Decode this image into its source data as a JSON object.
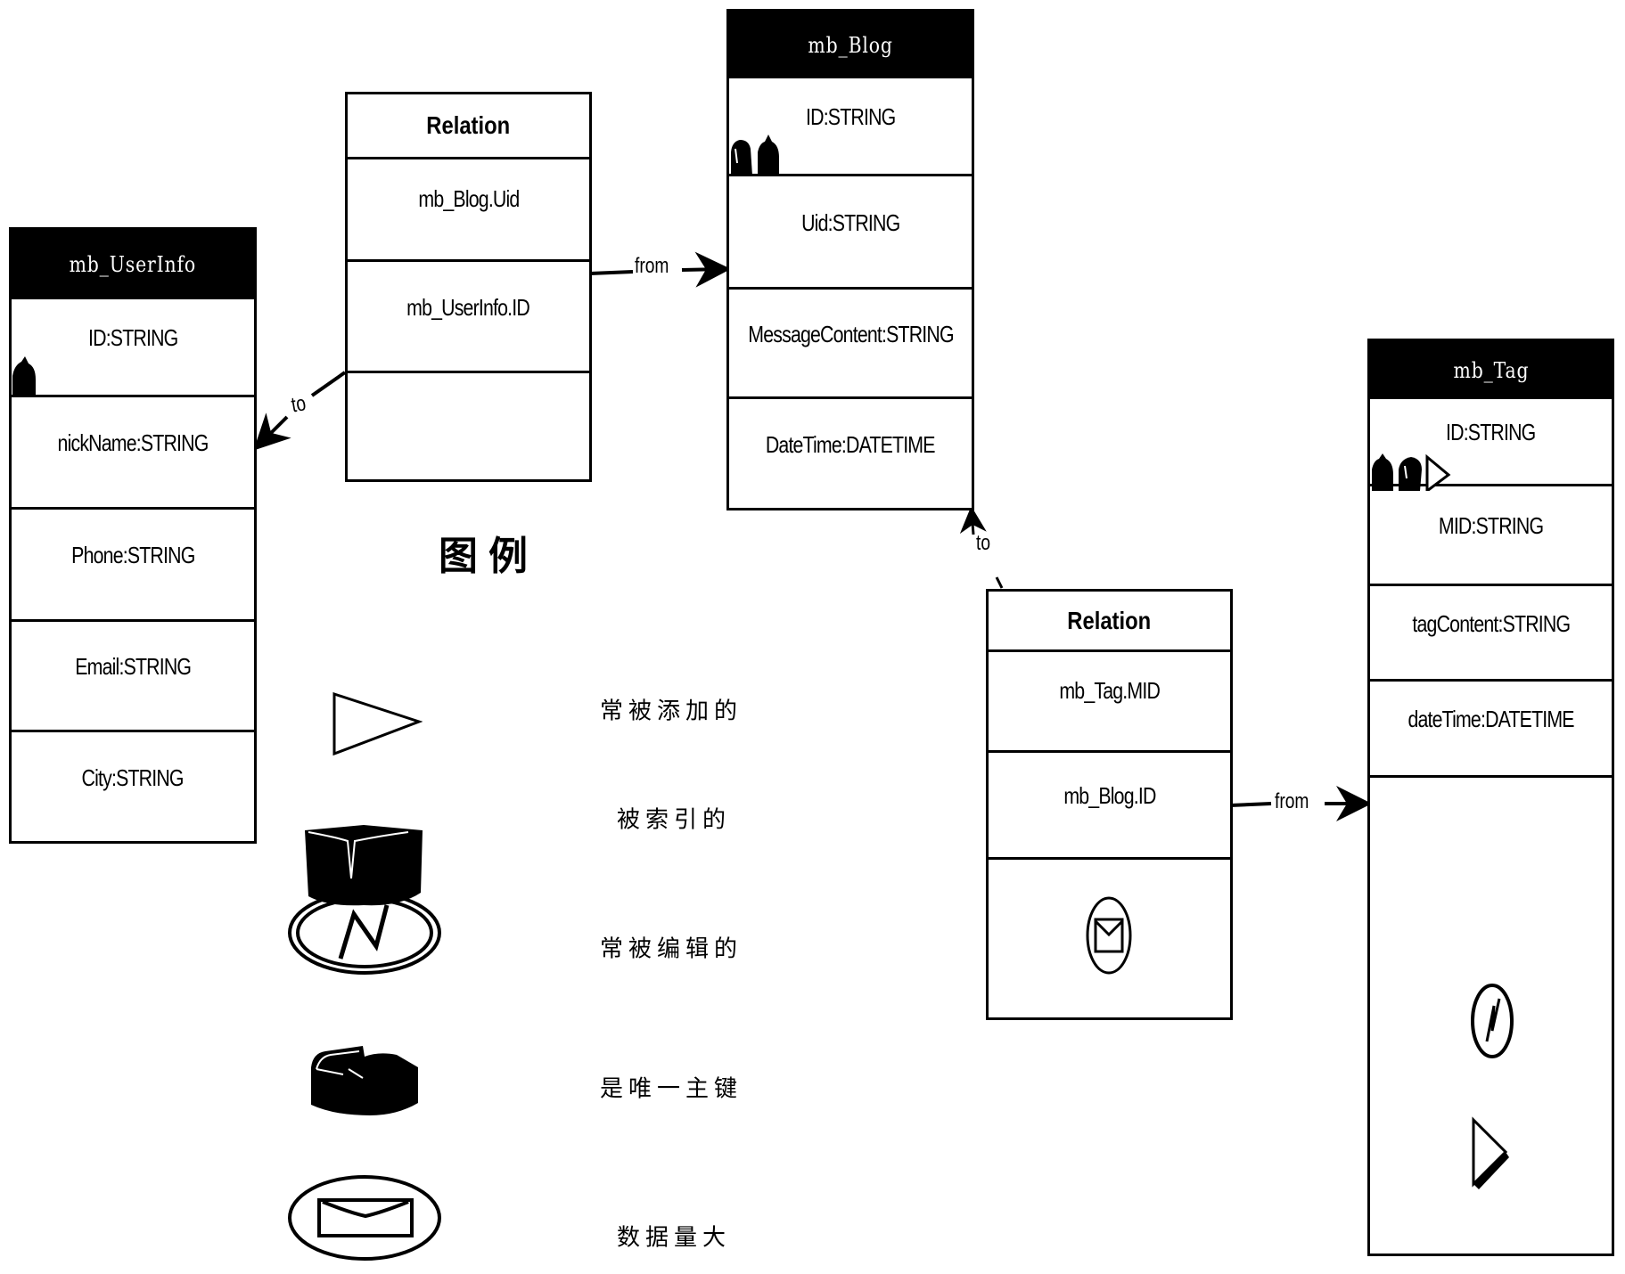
{
  "diagram": {
    "entities": {
      "userinfo": {
        "title": "mb_UserInfo",
        "fields": [
          "ID:STRING",
          "nickName:STRING",
          "Phone:STRING",
          "Email:STRING",
          "City:STRING"
        ]
      },
      "relation1": {
        "title": "Relation",
        "fields": [
          "mb_Blog.Uid",
          "mb_UserInfo.ID"
        ]
      },
      "blog": {
        "title": "mb_Blog",
        "fields": [
          "ID:STRING",
          "Uid:STRING",
          "MessageContent:STRING",
          "DateTime:DATETIME"
        ]
      },
      "relation2": {
        "title": "Relation",
        "fields": [
          "mb_Tag.MID",
          "mb_Blog.ID"
        ],
        "marker_icons": [
          "large-data-icon"
        ]
      },
      "tag": {
        "title": "mb_Tag",
        "fields": [
          "ID:STRING",
          "MID:STRING",
          "tagContent:STRING",
          "dateTime:DATETIME"
        ],
        "marker_icons": [
          "frequently-edited-icon",
          "frequently-added-icon"
        ]
      }
    },
    "connectors": [
      {
        "label": "from",
        "from": "relation1",
        "to": "blog"
      },
      {
        "label": "to",
        "from": "relation1",
        "to": "userinfo"
      },
      {
        "label": "to",
        "from": "relation2",
        "to": "blog"
      },
      {
        "label": "from",
        "from": "relation2",
        "to": "tag"
      }
    ],
    "field_badges": {
      "userinfo_id": [
        "primary-key-icon"
      ],
      "blog_id": [
        "primary-key-icon",
        "indexed-icon"
      ],
      "tag_id": [
        "primary-key-icon",
        "indexed-icon",
        "frequently-added-icon"
      ]
    }
  },
  "legend": {
    "title": "图例",
    "items": [
      {
        "icon": "frequently-added-icon",
        "label": "常被添加的"
      },
      {
        "icon": "indexed-icon",
        "label": "被索引的"
      },
      {
        "icon": "frequently-edited-icon",
        "label": "常被编辑的"
      },
      {
        "icon": "primary-key-icon",
        "label": "是唯一主键"
      },
      {
        "icon": "large-data-icon",
        "label": "数据量大"
      }
    ]
  }
}
